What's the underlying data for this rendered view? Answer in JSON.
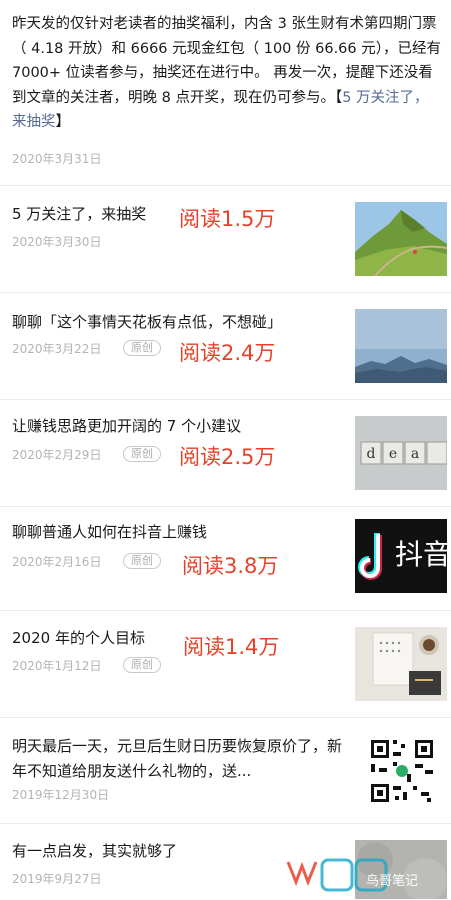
{
  "feed": {
    "post0": {
      "text": "昨天发的仅针对老读者的抽奖福利，内含 3 张生财有术第四期门票（ 4.18 开放）和 6666 元现金红包（ 100 份 66.66 元），已经有 7000+ 位读者参与，抽奖还在进行中。 再发一次，提醒下还没看到文章的关注者，明晚 8 点开奖，现在仍可参与。【",
      "link": "5 万关注了，来抽奖",
      "close": "】",
      "date": "2020年3月31日"
    },
    "items": [
      {
        "title": "5 万关注了，来抽奖",
        "date": "2020年3月30日",
        "reads": "阅读1.5万",
        "thumb": "mountain-trail"
      },
      {
        "title": "聊聊「这个事情天花板有点低，不想碰」",
        "date": "2020年3月22日",
        "original": "原创",
        "reads": "阅读2.4万",
        "thumb": "blue-mountains"
      },
      {
        "title": "让赚钱思路更加开阔的 7 个小建议",
        "date": "2020年2月29日",
        "original": "原创",
        "reads": "阅读2.5万",
        "thumb": "idea-blocks"
      },
      {
        "title": "聊聊普通人如何在抖音上赚钱",
        "date": "2020年2月16日",
        "original": "原创",
        "reads": "阅读3.8万",
        "thumb": "douyin-logo",
        "thumb_text": "抖音"
      },
      {
        "title": "2020 年的个人目标",
        "date": "2020年1月12日",
        "original": "原创",
        "reads": "阅读1.4万",
        "thumb": "desk-notebook"
      },
      {
        "title": "明天最后一天，元旦后生财日历要恢复原价了，新年不知道给朋友送什么礼物的，送...",
        "date": "2019年12月30日",
        "thumb": "qr-code"
      },
      {
        "title": "有一点启发，其实就够了",
        "date": "2019年9月27日",
        "thumb": "gray-texture"
      }
    ]
  },
  "watermark": {
    "text": "鸟哥笔记"
  },
  "colors": {
    "reads": "#e8412a",
    "link": "#576b95",
    "date": "#b4b4b4"
  }
}
